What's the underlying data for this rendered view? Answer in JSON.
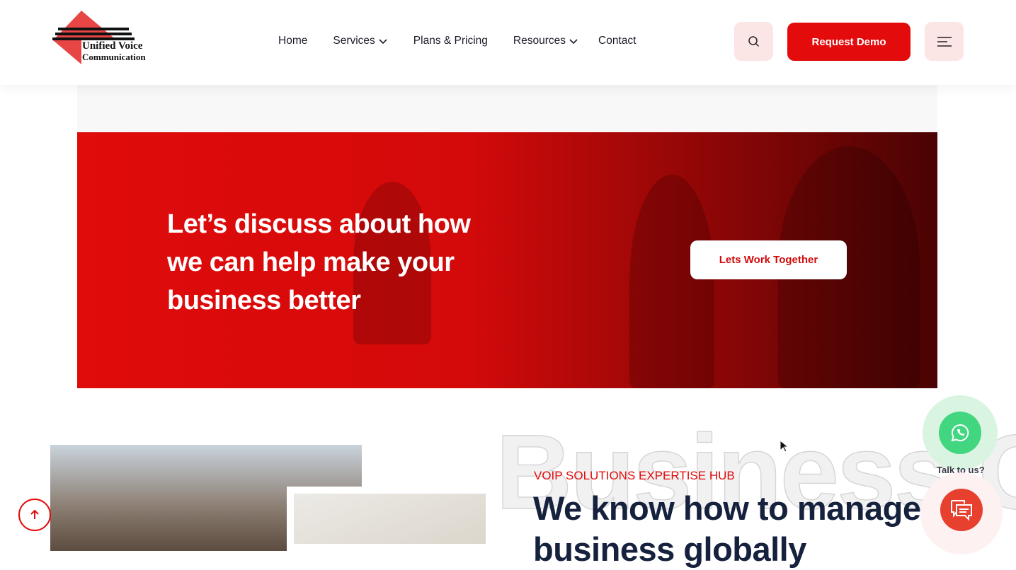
{
  "logo": {
    "line1": "Unified Voice",
    "line2": "Communication"
  },
  "nav": [
    {
      "label": "Home"
    },
    {
      "label": "Services"
    },
    {
      "label": "Plans & Pricing"
    },
    {
      "label": "Resources"
    },
    {
      "label": "Contact"
    }
  ],
  "header": {
    "demo_label": "Request Demo"
  },
  "cta": {
    "heading": "Let’s discuss about how we can help make your business better",
    "button": "Lets Work Together"
  },
  "about": {
    "bg_word": "Business G",
    "eyebrow": "VOIP SOLUTIONS EXPERTISE HUB",
    "headline": "We know how to manage business globally"
  },
  "widgets": {
    "talk_label": "Talk to us?"
  },
  "colors": {
    "brand": "#e30b0b",
    "whatsapp": "#41d67f",
    "chat": "#e8402f"
  }
}
